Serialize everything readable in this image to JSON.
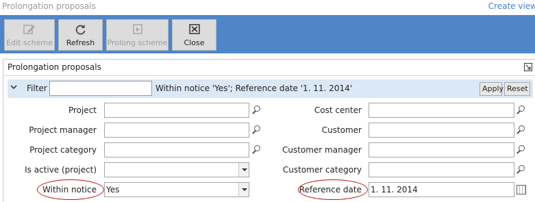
{
  "page": {
    "title": "Prolongation proposals",
    "create_view": "Create view"
  },
  "toolbar": {
    "edit_scheme": "Edit scheme",
    "refresh": "Refresh",
    "prolong_scheme": "Prolong scheme",
    "close": "Close"
  },
  "panel": {
    "title": "Prolongation proposals"
  },
  "filter": {
    "label": "Filter",
    "value": "",
    "summary": "Within notice 'Yes'; Reference date '1. 11. 2014'",
    "apply": "Apply",
    "reset": "Reset"
  },
  "fields": {
    "project": {
      "label": "Project",
      "value": ""
    },
    "project_manager": {
      "label": "Project manager",
      "value": ""
    },
    "project_category": {
      "label": "Project category",
      "value": ""
    },
    "is_active": {
      "label": "Is active (project)",
      "value": ""
    },
    "within_notice": {
      "label": "Within notice",
      "value": "Yes"
    },
    "cost_center": {
      "label": "Cost center",
      "value": ""
    },
    "customer": {
      "label": "Customer",
      "value": ""
    },
    "customer_manager": {
      "label": "Customer manager",
      "value": ""
    },
    "customer_category": {
      "label": "Customer category",
      "value": ""
    },
    "reference_date": {
      "label": "Reference date",
      "value": "1. 11. 2014"
    }
  },
  "colors": {
    "toolbar": "#4f86c9",
    "filter_bar": "#dbe8f5",
    "highlight": "#c01010",
    "link": "#4a80c8"
  }
}
